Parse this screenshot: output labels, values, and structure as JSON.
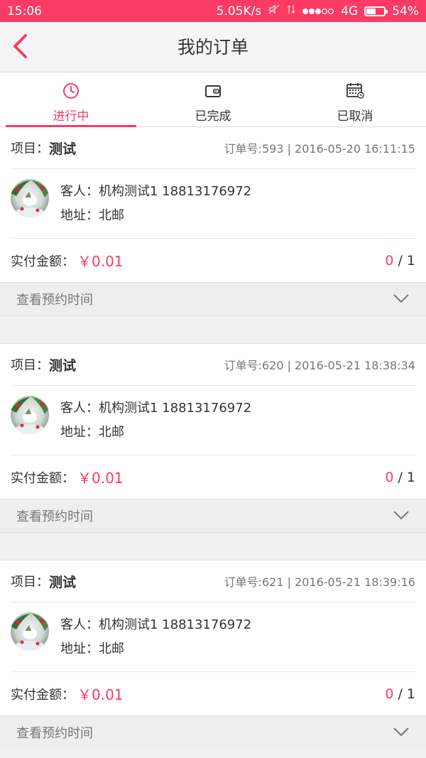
{
  "status_bar": {
    "time": "15:06",
    "speed": "5.05K/s",
    "network": "4G",
    "battery": "54%",
    "battery_level": 0.54
  },
  "header": {
    "title": "我的订单"
  },
  "tabs": [
    {
      "label": "进行中",
      "icon": "clock-icon",
      "active": true
    },
    {
      "label": "已完成",
      "icon": "wallet-icon",
      "active": false
    },
    {
      "label": "已取消",
      "icon": "calendar-icon",
      "active": false
    }
  ],
  "colors": {
    "accent": "#fb3b64"
  },
  "orders": [
    {
      "project_label": "项目：",
      "project_name": "测试",
      "meta": "订单号:593 | 2016-05-20 16:11:15",
      "customer": "客人：机构测试1 18813176972",
      "address": "地址：北邮",
      "pay_label": "实付金额：",
      "pay_amount": "￥0.01",
      "done": "0",
      "total": " / 1",
      "toggle_label": "查看预约时间"
    },
    {
      "project_label": "项目：",
      "project_name": "测试",
      "meta": "订单号:620 | 2016-05-21 18:38:34",
      "customer": "客人：机构测试1 18813176972",
      "address": "地址：北邮",
      "pay_label": "实付金额：",
      "pay_amount": "￥0.01",
      "done": "0",
      "total": " / 1",
      "toggle_label": "查看预约时间"
    },
    {
      "project_label": "项目：",
      "project_name": "测试",
      "meta": "订单号:621 | 2016-05-21 18:39:16",
      "customer": "客人：机构测试1 18813176972",
      "address": "地址：北邮",
      "pay_label": "实付金额：",
      "pay_amount": "￥0.01",
      "done": "0",
      "total": " / 1",
      "toggle_label": "查看预约时间"
    }
  ]
}
